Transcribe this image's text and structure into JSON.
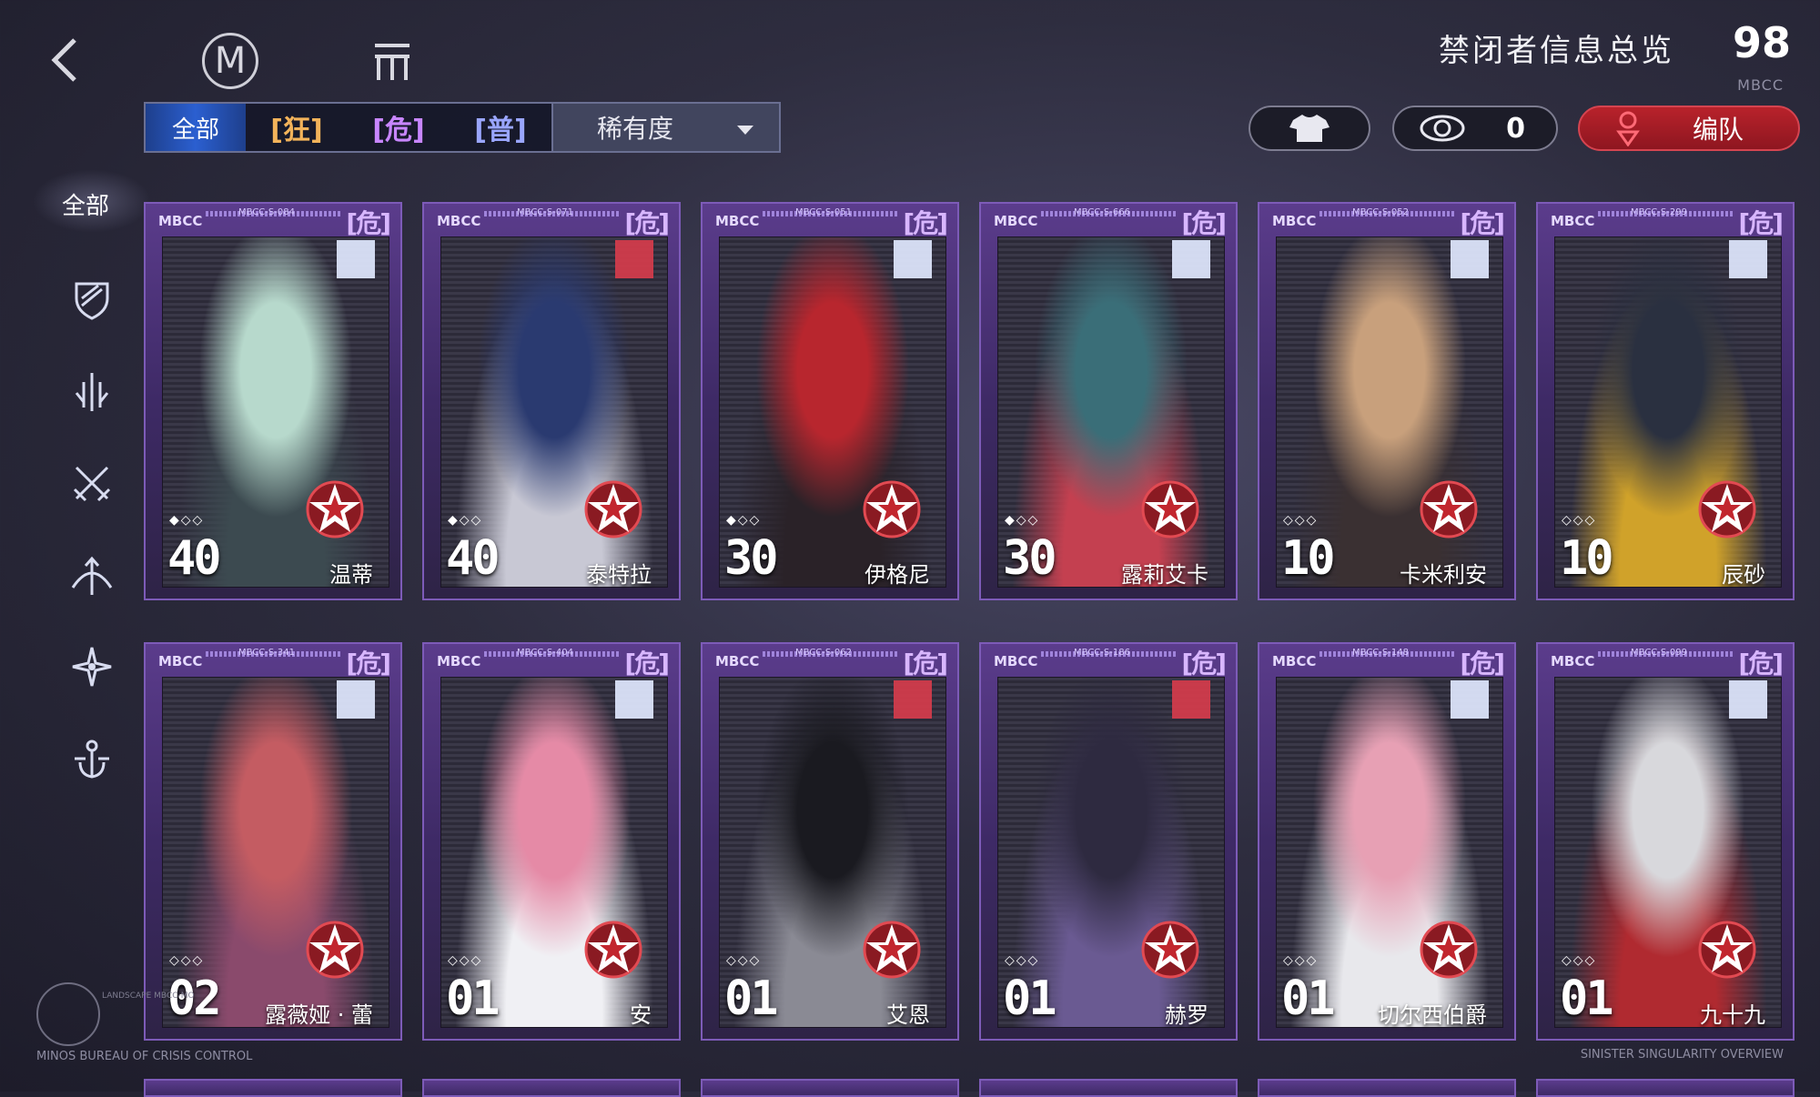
{
  "header": {
    "title": "禁闭者信息总览",
    "count": "98",
    "sub_label": "MBCC"
  },
  "filters": {
    "all": "全部",
    "kuang": "[狂]",
    "wei": "[危]",
    "pu": "[普]",
    "sort": "稀有度"
  },
  "actions": {
    "eye_count": "0",
    "team": "编队"
  },
  "sidebar": {
    "all": "全部",
    "icons": [
      "shield-icon",
      "sword-icon",
      "crossed-swords-icon",
      "bow-icon",
      "star-compass-icon",
      "anchor-icon"
    ]
  },
  "cards": [
    {
      "code": "MBCC-S-084",
      "tier": "[危]",
      "level": "40",
      "name": "温蒂",
      "stars": "◆◇◇",
      "class_icon": "staff-icon",
      "class_color": "light"
    },
    {
      "code": "MBCC-S-071",
      "tier": "[危]",
      "level": "40",
      "name": "泰特拉",
      "stars": "◆◇◇",
      "class_icon": "crossed-swords-icon",
      "class_color": "red"
    },
    {
      "code": "MBCC-S-051",
      "tier": "[危]",
      "level": "30",
      "name": "伊格尼",
      "stars": "◆◇◇",
      "class_icon": "star-compass-icon",
      "class_color": "light"
    },
    {
      "code": "MBCC-S-666",
      "tier": "[危]",
      "level": "30",
      "name": "露莉艾卡",
      "stars": "◆◇◇",
      "class_icon": "bow-icon",
      "class_color": "light"
    },
    {
      "code": "MBCC-S-052",
      "tier": "[危]",
      "level": "10",
      "name": "卡米利安",
      "stars": "◇◇◇",
      "class_icon": "anchor-icon",
      "class_color": "light"
    },
    {
      "code": "MBCC-S-299",
      "tier": "[危]",
      "level": "10",
      "name": "辰砂",
      "stars": "◇◇◇",
      "class_icon": "shield-icon",
      "class_color": "light"
    },
    {
      "code": "MBCC-S-341",
      "tier": "[危]",
      "level": "02",
      "name": "露薇娅 · 蕾",
      "stars": "◇◇◇",
      "class_icon": "star-compass-icon",
      "class_color": "light"
    },
    {
      "code": "MBCC-S-404",
      "tier": "[危]",
      "level": "01",
      "name": "安",
      "stars": "◇◇◇",
      "class_icon": "anchor-icon",
      "class_color": "light"
    },
    {
      "code": "MBCC-S-062",
      "tier": "[危]",
      "level": "01",
      "name": "艾恩",
      "stars": "◇◇◇",
      "class_icon": "crossed-swords-icon",
      "class_color": "red"
    },
    {
      "code": "MBCC-S-186",
      "tier": "[危]",
      "level": "01",
      "name": "赫罗",
      "stars": "◇◇◇",
      "class_icon": "staff-icon",
      "class_color": "red"
    },
    {
      "code": "MBCC-S-148",
      "tier": "[危]",
      "level": "01",
      "name": "切尔西伯爵",
      "stars": "◇◇◇",
      "class_icon": "shield-icon",
      "class_color": "light"
    },
    {
      "code": "MBCC-S-099",
      "tier": "[危]",
      "level": "01",
      "name": "九十九",
      "stars": "◇◇◇",
      "class_icon": "staff-icon",
      "class_color": "light"
    }
  ],
  "footer": {
    "left": "MINOS BUREAU OF CRISIS CONTROL",
    "right": "SINISTER SINGULARITY OVERVIEW",
    "seal_text": "LANDSCAPE MBCC-MO"
  },
  "colors": {
    "accent_red": "#b8222b",
    "tier_purple": "#d8b6ff",
    "kuang_gold": "#f3b35a"
  }
}
